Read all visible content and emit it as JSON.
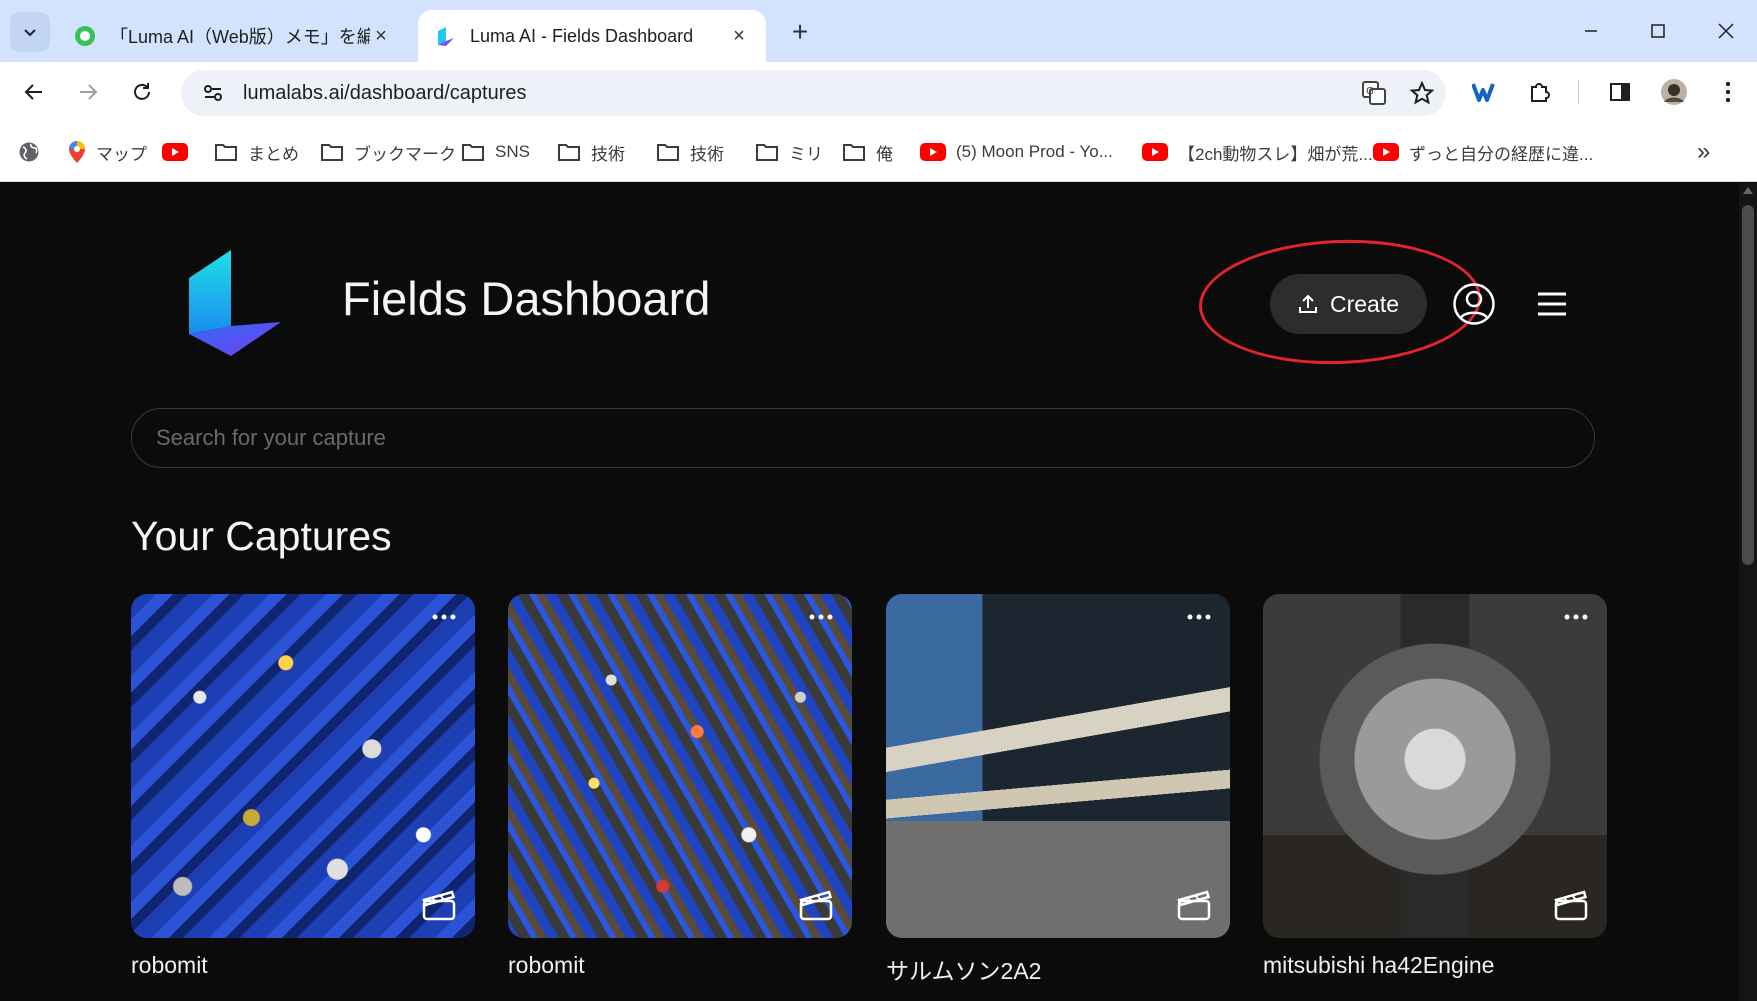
{
  "browser": {
    "tabs": [
      {
        "title": "「Luma AI（Web版）メモ」を編集",
        "close": "×",
        "active": false
      },
      {
        "title": "Luma AI - Fields Dashboard",
        "close": "×",
        "active": true
      }
    ],
    "new_tab": "+",
    "url": "lumalabs.ai/dashboard/captures",
    "bookmarks": [
      {
        "label": "",
        "icon": "globe-icon"
      },
      {
        "label": "マップ",
        "icon": "maps-pin-icon"
      },
      {
        "label": "",
        "icon": "youtube-icon"
      },
      {
        "label": "まとめ",
        "icon": "folder-icon"
      },
      {
        "label": "ブックマーク",
        "icon": "folder-icon"
      },
      {
        "label": "SNS",
        "icon": "folder-icon"
      },
      {
        "label": "技術",
        "icon": "folder-icon"
      },
      {
        "label": "技術",
        "icon": "folder-icon"
      },
      {
        "label": "ミリ",
        "icon": "folder-icon"
      },
      {
        "label": "俺",
        "icon": "folder-icon"
      },
      {
        "label": "(5) Moon Prod - Yo...",
        "icon": "youtube-icon"
      },
      {
        "label": "【2ch動物スレ】畑が荒...",
        "icon": "youtube-icon"
      },
      {
        "label": "ずっと自分の経歴に違...",
        "icon": "youtube-icon"
      }
    ],
    "overflow": "»"
  },
  "header": {
    "title": "Fields Dashboard",
    "create_label": "Create"
  },
  "search": {
    "placeholder": "Search for your capture"
  },
  "captures": {
    "title": "Your Captures",
    "items": [
      {
        "name": "robomit"
      },
      {
        "name": "robomit"
      },
      {
        "name": "サルムソン2A2"
      },
      {
        "name": "mitsubishi ha42Engine"
      }
    ]
  },
  "colors": {
    "page_bg": "#0b0b0b",
    "button_bg": "#2d2d2d",
    "highlight_ring": "#e3242b",
    "tabstrip": "#d3e3fd"
  }
}
